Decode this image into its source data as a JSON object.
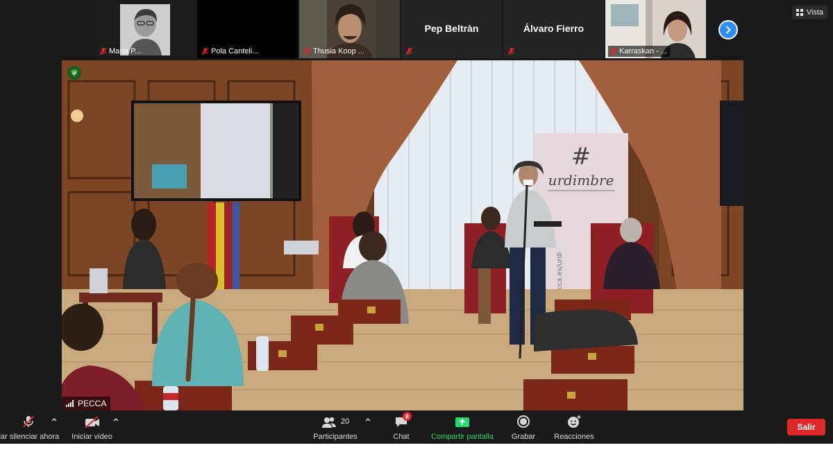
{
  "participants": [
    {
      "name": "Marta P...",
      "muted": true,
      "video": true
    },
    {
      "name": "Pola Canteli...",
      "muted": true,
      "video": false
    },
    {
      "name": "Thusia Koop ...",
      "muted": true,
      "video": true
    },
    {
      "name": "Pep Beltràn",
      "muted": true,
      "video": false
    },
    {
      "name": "Álvaro Fierro",
      "muted": true,
      "video": false
    },
    {
      "name": "Karraskan - ...",
      "muted": true,
      "video": true
    }
  ],
  "view_menu": {
    "label": "Vista",
    "icon": "grid-icon"
  },
  "main_video": {
    "speaker": "PECCA",
    "banner_hash": "#",
    "banner_word": "urdimbre",
    "banner_url": "pecca.es/urdi"
  },
  "toolbar": {
    "mute": {
      "label": "Cancelar silenciar ahora"
    },
    "video": {
      "label": "Iniciar video"
    },
    "participants": {
      "label": "Participantes",
      "count": "20"
    },
    "chat": {
      "label": "Chat",
      "badge": "8"
    },
    "share": {
      "label": "Compartir pantalla"
    },
    "record": {
      "label": "Grabar"
    },
    "reactions": {
      "label": "Reacciones"
    },
    "leave": {
      "label": "Salir"
    }
  },
  "colors": {
    "accent_blue": "#2d8cff",
    "share_green": "#23d96a",
    "leave_red": "#e02828",
    "background": "#1a1a1a"
  }
}
